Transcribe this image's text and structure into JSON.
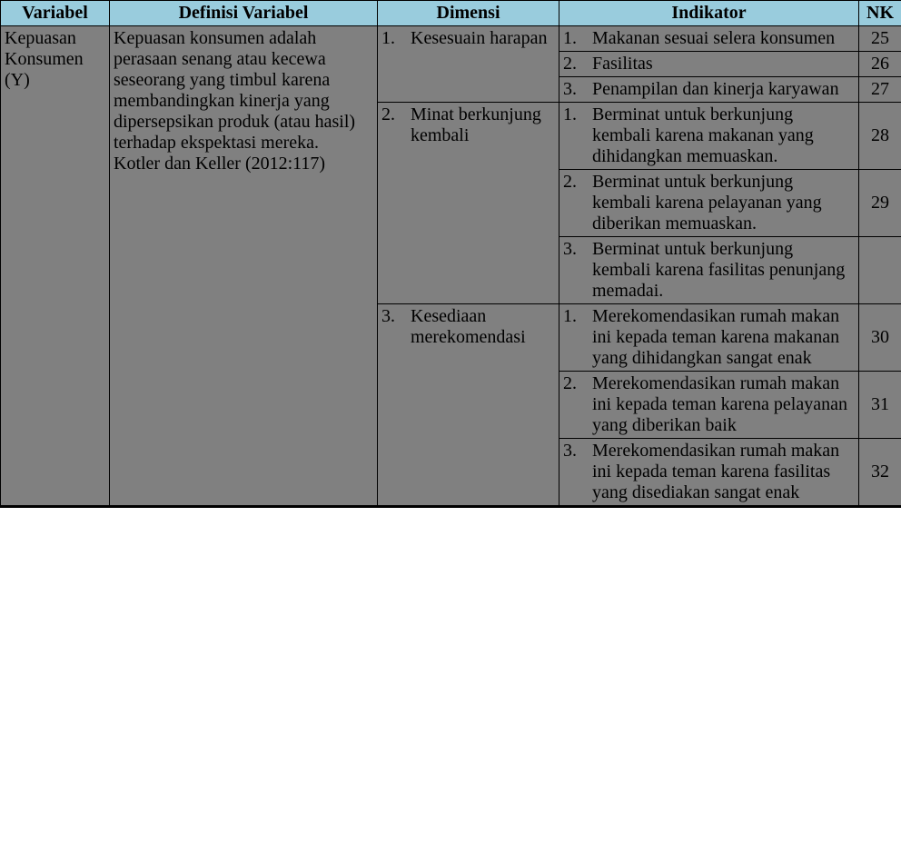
{
  "headers": {
    "variabel": "Variabel",
    "definisi": "Definisi Variabel",
    "dimensi": "Dimensi",
    "indikator": "Indikator",
    "nk": "NK"
  },
  "variabel": "Kepuasan Konsumen (Y)",
  "definisi": "Kepuasan konsumen adalah perasaan senang atau kecewa seseorang yang timbul karena membandingkan kinerja yang dipersepsikan produk (atau hasil) terhadap ekspektasi mereka.\nKotler dan Keller (2012:117)",
  "dimensi": [
    {
      "num": "1.",
      "text": "Kesesuain harapan"
    },
    {
      "num": "2.",
      "text": "Minat berkunjung kembali"
    },
    {
      "num": "3.",
      "text": "Kesediaan merekomendasi"
    }
  ],
  "rows": [
    {
      "ind_num": "1.",
      "ind_text": "Makanan sesuai selera konsumen",
      "nk": "25"
    },
    {
      "ind_num": "2.",
      "ind_text": "Fasilitas",
      "nk": "26"
    },
    {
      "ind_num": "3.",
      "ind_text": "Penampilan dan kinerja karyawan",
      "nk": "27"
    },
    {
      "ind_num": "1.",
      "ind_text": "Berminat untuk berkunjung kembali karena makanan yang dihidangkan memuaskan.",
      "nk": "28"
    },
    {
      "ind_num": "2.",
      "ind_text": "Berminat untuk berkunjung kembali karena pelayanan yang diberikan memuaskan.",
      "nk": "29"
    },
    {
      "ind_num": "3.",
      "ind_text": "Berminat untuk berkunjung kembali karena fasilitas penunjang memadai.",
      "nk": ""
    },
    {
      "ind_num": "1.",
      "ind_text": "Merekomendasikan rumah makan ini kepada teman karena makanan yang dihidangkan sangat enak",
      "nk": "30"
    },
    {
      "ind_num": "2.",
      "ind_text": "Merekomendasikan rumah makan ini kepada teman karena pelayanan yang diberikan baik",
      "nk": "31"
    },
    {
      "ind_num": "3.",
      "ind_text": "Merekomendasikan rumah makan ini kepada teman karena fasilitas yang disediakan sangat enak",
      "nk": "32"
    }
  ]
}
